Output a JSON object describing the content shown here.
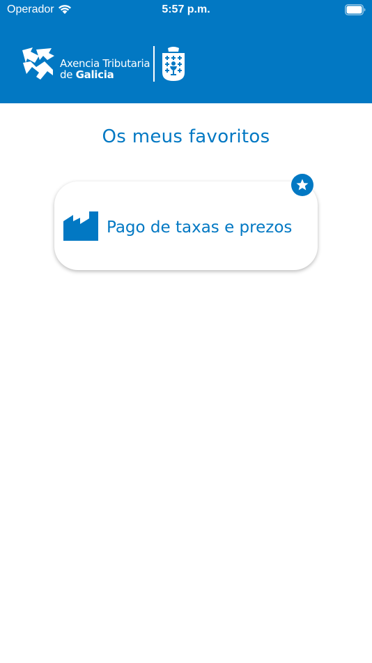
{
  "status_bar": {
    "carrier": "Operador",
    "time": "5:57 p.m."
  },
  "header": {
    "logo_line1": "Axencia Tributaria",
    "logo_line2_prefix": "de ",
    "logo_line2_bold": "Galicia"
  },
  "main": {
    "title": "Os meus favoritos",
    "favorites": [
      {
        "label": "Pago de taxas e prezos",
        "icon": "factory-icon",
        "starred": true
      }
    ]
  },
  "colors": {
    "brand_blue": "#0278c3",
    "background": "#ffffff"
  }
}
